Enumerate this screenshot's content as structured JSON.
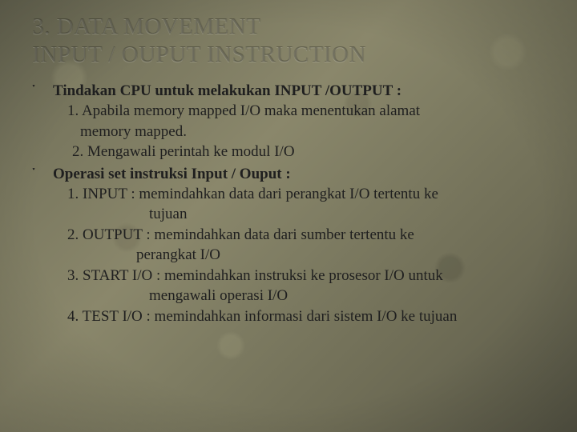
{
  "title_line1": "3. DATA MOVEMENT",
  "title_line2": "INPUT / OUPUT INSTRUCTION",
  "bullet_marker": "་",
  "section1": {
    "heading": "Tindakan CPU untuk melakukan INPUT /OUTPUT :",
    "l1": "1. Apabila  memory mapped I/O maka menentukan alamat",
    "l2": "memory mapped.",
    "l3": "2. Mengawali perintah ke modul I/O"
  },
  "section2": {
    "heading": "Operasi set instruksi Input / Ouput :",
    "l1": "1. INPUT : memindahkan data dari perangkat I/O tertentu ke",
    "l1b": "tujuan",
    "l2": "2. OUTPUT : memindahkan data dari sumber tertentu ke",
    "l2b": "perangkat I/O",
    "l3": "3. START I/O : memindahkan instruksi ke prosesor I/O untuk",
    "l3b": "mengawali operasi I/O",
    "l4": "4. TEST I/O : memindahkan informasi dari sistem I/O ke tujuan"
  }
}
